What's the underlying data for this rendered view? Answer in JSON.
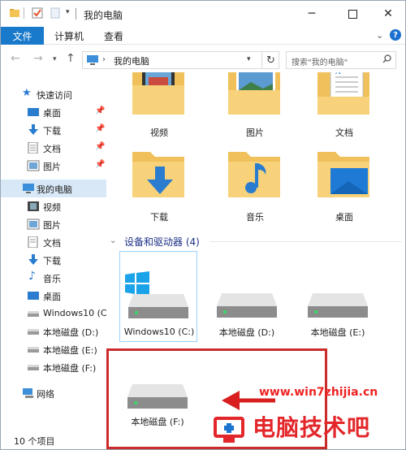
{
  "window": {
    "title": "我的电脑",
    "accent": "#1979ca"
  },
  "ribbon": {
    "tabs": [
      "文件",
      "计算机",
      "查看"
    ]
  },
  "address": {
    "path": "我的电脑",
    "search_placeholder": "搜索\"我的电脑\""
  },
  "sidebar": {
    "quick_access": "快速访问",
    "quick_items": [
      {
        "label": "桌面",
        "icon": "desktop-icon"
      },
      {
        "label": "下载",
        "icon": "download-icon"
      },
      {
        "label": "文档",
        "icon": "document-icon"
      },
      {
        "label": "图片",
        "icon": "picture-icon"
      }
    ],
    "this_pc": "我的电脑",
    "pc_items": [
      {
        "label": "视频",
        "icon": "video-icon"
      },
      {
        "label": "图片",
        "icon": "picture-icon"
      },
      {
        "label": "文档",
        "icon": "document-icon"
      },
      {
        "label": "下载",
        "icon": "download-icon"
      },
      {
        "label": "音乐",
        "icon": "music-icon"
      },
      {
        "label": "桌面",
        "icon": "desktop-icon"
      },
      {
        "label": "Windows10 (C",
        "icon": "drive-icon"
      },
      {
        "label": "本地磁盘 (D:)",
        "icon": "drive-icon"
      },
      {
        "label": "本地磁盘 (E:)",
        "icon": "drive-icon"
      },
      {
        "label": "本地磁盘 (F:)",
        "icon": "drive-icon"
      }
    ],
    "network": "网络"
  },
  "folders": [
    {
      "label": "视频",
      "icon": "video-folder-icon"
    },
    {
      "label": "图片",
      "icon": "picture-folder-icon"
    },
    {
      "label": "文档",
      "icon": "document-folder-icon"
    },
    {
      "label": "下载",
      "icon": "download-folder-icon"
    },
    {
      "label": "音乐",
      "icon": "music-folder-icon"
    },
    {
      "label": "桌面",
      "icon": "desktop-folder-icon"
    }
  ],
  "devices": {
    "header": "设备和驱动器 (4)",
    "drives": [
      {
        "label": "Windows10 (C:)"
      },
      {
        "label": "本地磁盘 (D:)"
      },
      {
        "label": "本地磁盘 (E:)"
      },
      {
        "label": "本地磁盘 (F:)"
      }
    ]
  },
  "status": {
    "item_count": "10 个项目"
  },
  "watermark": {
    "url": "www.win7zhijia.cn",
    "brand": "电脑技术吧"
  }
}
